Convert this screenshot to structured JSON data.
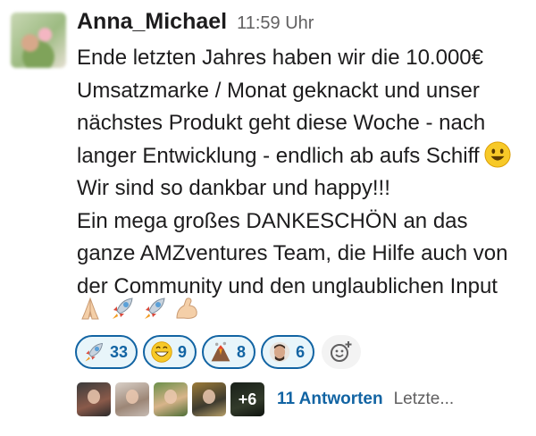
{
  "message": {
    "username": "Anna_Michael",
    "time": "11:59 Uhr",
    "lines": [
      "Ende letzten Jahres haben wir die 10.000€",
      "Umsatzmarke / Monat geknackt und unser",
      "nächstes Produkt geht diese Woche - nach",
      "langer Entwicklung - endlich ab aufs Schiff",
      "Wir sind so dankbar und happy!!!",
      "Ein mega großes DANKESCHÖN an das",
      "ganze AMZventures Team, die Hilfe auch von",
      "der Community und den unglaublichen Input"
    ],
    "inline_emoji": "smiley-emoji",
    "trailing_emojis": [
      "folded-hands-emoji",
      "rocket-emoji",
      "rocket-emoji",
      "flexed-biceps-emoji"
    ]
  },
  "reactions": [
    {
      "icon": "rocket-emoji",
      "count": "33"
    },
    {
      "icon": "grinning-emoji",
      "count": "9"
    },
    {
      "icon": "volcano-emoji",
      "count": "8"
    },
    {
      "icon": "custom-face-emoji",
      "count": "6"
    }
  ],
  "add_reaction_icon": "add-reaction-icon",
  "thread": {
    "more_count": "+6",
    "replies_label": "11 Antworten",
    "last_reply": "Letzte..."
  },
  "colors": {
    "link_blue": "#1264a3",
    "reaction_bg": "#e8f5fa",
    "muted": "#616061"
  }
}
